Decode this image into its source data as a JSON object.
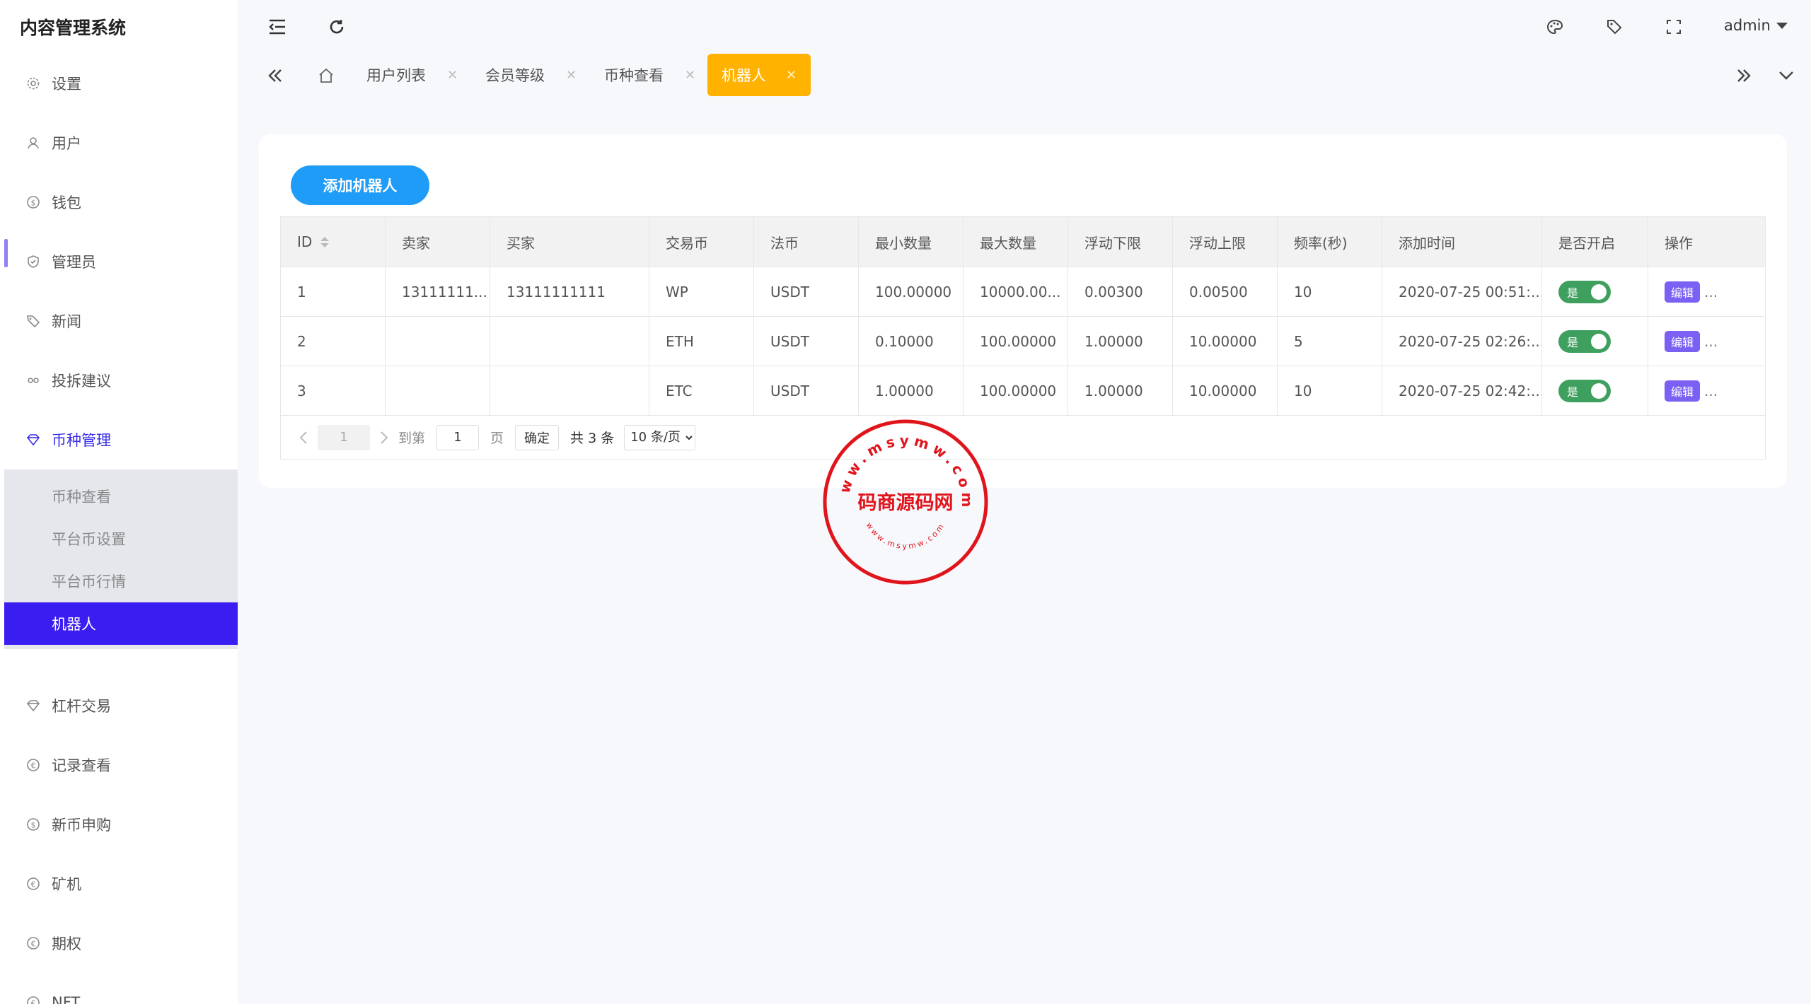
{
  "app": {
    "title": "内容管理系统"
  },
  "sidebar": {
    "items": [
      {
        "label": "设置",
        "icon": "gear-icon"
      },
      {
        "label": "用户",
        "icon": "user-icon"
      },
      {
        "label": "钱包",
        "icon": "dollar-icon"
      },
      {
        "label": "管理员",
        "icon": "shield-icon"
      },
      {
        "label": "新闻",
        "icon": "tag-icon"
      },
      {
        "label": "投拆建议",
        "icon": "link-icon"
      },
      {
        "label": "币种管理",
        "icon": "diamond-icon"
      },
      {
        "label": "杠杆交易",
        "icon": "diamond-icon"
      },
      {
        "label": "记录查看",
        "icon": "euro-icon"
      },
      {
        "label": "新币申购",
        "icon": "dollar-icon"
      },
      {
        "label": "矿机",
        "icon": "euro-icon"
      },
      {
        "label": "期权",
        "icon": "euro-icon"
      },
      {
        "label": "NFT",
        "icon": "euro-icon"
      }
    ],
    "submenu": [
      {
        "label": "币种查看"
      },
      {
        "label": "平台币设置"
      },
      {
        "label": "平台币行情"
      },
      {
        "label": "机器人"
      }
    ]
  },
  "header": {
    "user": "admin"
  },
  "tabs": [
    {
      "label": "用户列表"
    },
    {
      "label": "会员等级"
    },
    {
      "label": "币种查看"
    },
    {
      "label": "机器人"
    }
  ],
  "toolbar": {
    "add_label": "添加机器人"
  },
  "table": {
    "columns": [
      "ID",
      "卖家",
      "买家",
      "交易币",
      "法币",
      "最小数量",
      "最大数量",
      "浮动下限",
      "浮动上限",
      "频率(秒)",
      "添加时间",
      "是否开启",
      "操作"
    ],
    "rows": [
      {
        "id": "1",
        "seller": "13111111...",
        "buyer": "13111111111",
        "coin": "WP",
        "fiat": "USDT",
        "min": "100.00000",
        "max": "10000.00...",
        "low": "0.00300",
        "high": "0.00500",
        "freq": "10",
        "time": "2020-07-25 00:51:...",
        "enabled": "是",
        "edit": "编辑",
        "more": "..."
      },
      {
        "id": "2",
        "seller": "",
        "buyer": "",
        "coin": "ETH",
        "fiat": "USDT",
        "min": "0.10000",
        "max": "100.00000",
        "low": "1.00000",
        "high": "10.00000",
        "freq": "5",
        "time": "2020-07-25 02:26:...",
        "enabled": "是",
        "edit": "编辑",
        "more": "..."
      },
      {
        "id": "3",
        "seller": "",
        "buyer": "",
        "coin": "ETC",
        "fiat": "USDT",
        "min": "1.00000",
        "max": "100.00000",
        "low": "1.00000",
        "high": "10.00000",
        "freq": "10",
        "time": "2020-07-25 02:42:...",
        "enabled": "是",
        "edit": "编辑",
        "more": "..."
      }
    ]
  },
  "pagination": {
    "current": "1",
    "goto_label": "到第",
    "goto_value": "1",
    "page_label": "页",
    "confirm_label": "确定",
    "total_label": "共 3 条",
    "page_size": "10 条/页"
  },
  "watermark": {
    "top_text": "www.msymw.com",
    "main_text": "码商源码网",
    "bottom_text": "www.msymw.com",
    "color": "#e0141b"
  },
  "colors": {
    "accent": "#3a1df0",
    "tab_active": "#ffb300",
    "primary_button": "#1e9cf7",
    "toggle_on": "#3f9f5f",
    "edit_button": "#7b60f3"
  }
}
